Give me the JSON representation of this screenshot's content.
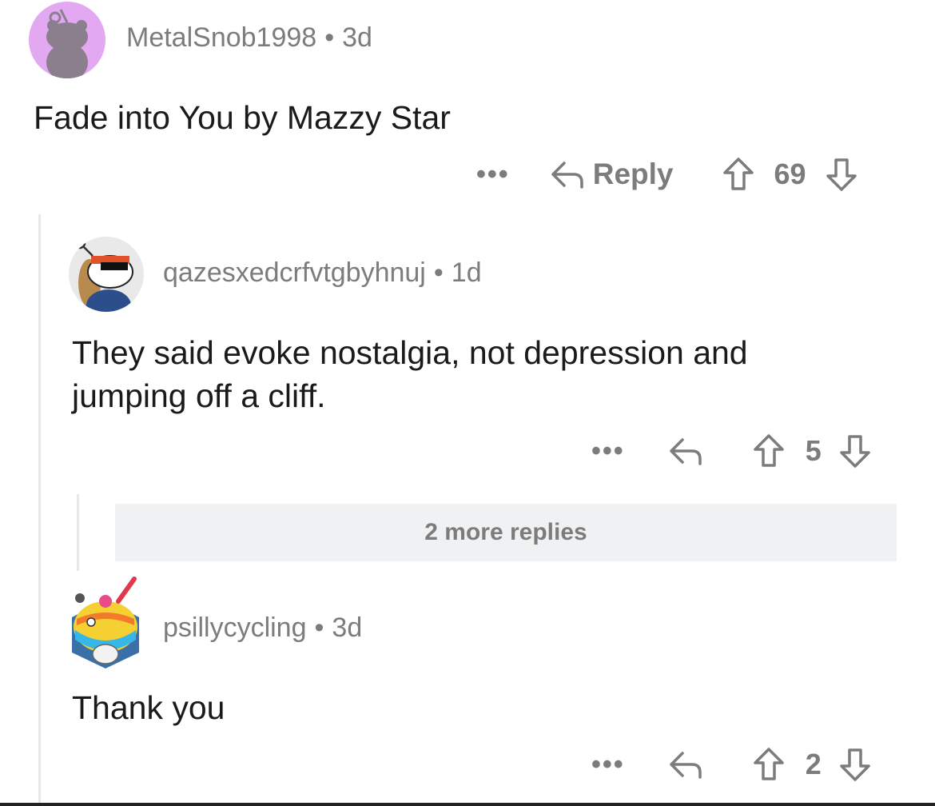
{
  "comments": [
    {
      "username": "MetalSnob1998",
      "age": "3d",
      "text": "Fade into You by Mazzy Star",
      "more": "•••",
      "reply_label": "Reply",
      "votes": "69"
    },
    {
      "username": "qazesxedcrfvtgbyhnuj",
      "age": "1d",
      "text": "They said evoke nostalgia, not depression and jumping off a cliff.",
      "more": "•••",
      "votes": "5"
    },
    {
      "username": "psillycycling",
      "age": "3d",
      "text": "Thank you",
      "more": "•••",
      "votes": "2"
    }
  ],
  "more_replies_label": "2 more replies",
  "separator": "•",
  "icons": [
    "reddit-snoo-avatar-icon",
    "reply-arrow-icon",
    "upvote-arrow-icon",
    "downvote-arrow-icon"
  ],
  "colors": {
    "text": "#1a1a1b",
    "meta": "#7c7c7c",
    "more_box": "#eff1f2",
    "thread_line": "#e8e8e8"
  }
}
